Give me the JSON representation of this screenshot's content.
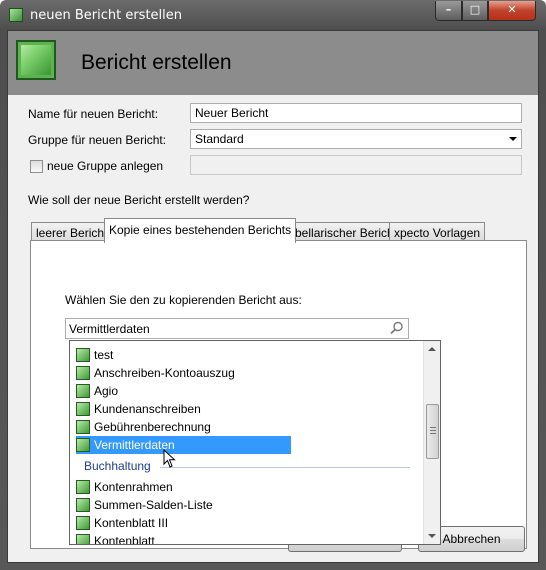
{
  "window": {
    "title": "neuen Bericht erstellen"
  },
  "header": {
    "title": "Bericht erstellen"
  },
  "form": {
    "name_label": "Name für neuen Bericht:",
    "name_value": "Neuer Bericht",
    "group_label": "Gruppe für neuen Bericht:",
    "group_value": "Standard",
    "new_group_label": "neue Gruppe anlegen",
    "new_group_checked": false,
    "new_group_value": "",
    "question": "Wie soll der neue Bericht erstellt werden?"
  },
  "tabs": [
    {
      "label": "leerer Bericht"
    },
    {
      "label": "Kopie eines bestehenden Berichts"
    },
    {
      "label": "tabellarischer Bericht"
    },
    {
      "label": "xpecto Vorlagen"
    }
  ],
  "active_tab": 1,
  "panel": {
    "prompt": "Wählen Sie den zu kopierenden Bericht aus:",
    "search_value": "Vermittlerdaten"
  },
  "list": {
    "items_group1": [
      {
        "label": "test"
      },
      {
        "label": "Anschreiben-Kontoauszug"
      },
      {
        "label": "Agio"
      },
      {
        "label": "Kundenanschreiben"
      },
      {
        "label": "Gebührenberechnung"
      },
      {
        "label": "Vermittlerdaten",
        "selected": true
      }
    ],
    "group2_header": "Buchhaltung",
    "items_group2": [
      {
        "label": "Kontenrahmen"
      },
      {
        "label": "Summen-Salden-Liste"
      },
      {
        "label": "Kontenblatt III"
      },
      {
        "label": "Kontenblatt"
      }
    ]
  },
  "buttons": {
    "cancel": "Abbrechen",
    "ok": ""
  },
  "colors": {
    "selection": "#3399ff",
    "group_header": "#1e3d8f",
    "header_band": "#8c8c8c"
  }
}
